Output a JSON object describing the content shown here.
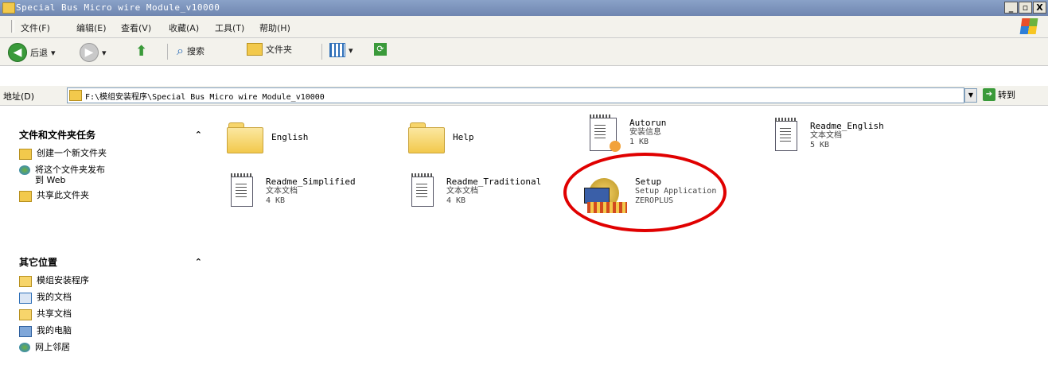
{
  "window": {
    "title": "Special Bus Micro wire Module_v10000",
    "buttons": [
      "_",
      "▫",
      "X"
    ]
  },
  "menu": {
    "items": [
      "文件(F)",
      "编辑(E)",
      "查看(V)",
      "收藏(A)",
      "工具(T)",
      "帮助(H)"
    ]
  },
  "toolbar": {
    "back_label": "后退",
    "search_label": "搜索",
    "folders_label": "文件夹"
  },
  "address": {
    "label": "地址(D)",
    "path": "F:\\模组安装程序\\Special Bus Micro wire Module_v10000",
    "go_label": "转到"
  },
  "tasks_panel": {
    "title": "文件和文件夹任务",
    "items": [
      "创建一个新文件夹",
      "将这个文件夹发布到 Web",
      "共享此文件夹"
    ]
  },
  "places_panel": {
    "title": "其它位置",
    "items": [
      "模组安装程序",
      "我的文档",
      "共享文档",
      "我的电脑",
      "网上邻居"
    ]
  },
  "files": [
    {
      "name": "English",
      "type": "folder"
    },
    {
      "name": "Help",
      "type": "folder"
    },
    {
      "name": "Autorun",
      "desc": "安装信息",
      "size": "1 KB",
      "type": "inf"
    },
    {
      "name": "Readme_English",
      "desc": "文本文档",
      "size": "5 KB",
      "type": "txt"
    },
    {
      "name": "Readme_Simplified",
      "desc": "文本文档",
      "size": "4 KB",
      "type": "txt"
    },
    {
      "name": "Readme_Traditional",
      "desc": "文本文档",
      "size": "4 KB",
      "type": "txt"
    },
    {
      "name": "Setup",
      "desc": "Setup Application",
      "company": "ZEROPLUS",
      "type": "exe"
    }
  ],
  "annotation": {
    "color": "#e00000"
  }
}
